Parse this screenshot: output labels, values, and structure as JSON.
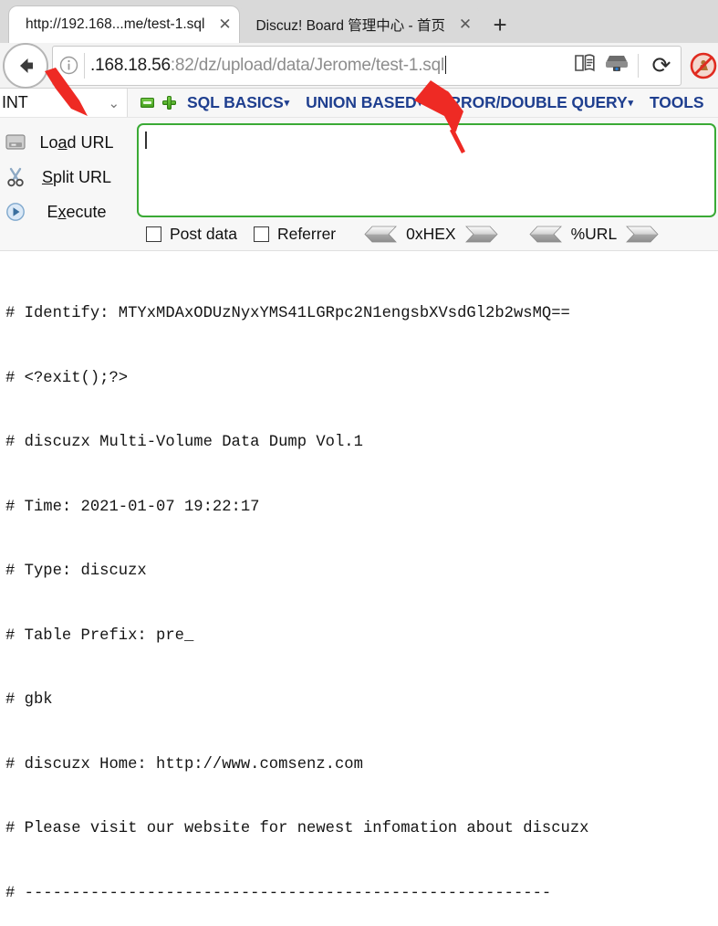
{
  "browser": {
    "tabs": [
      {
        "title": "http://192.168...me/test-1.sql",
        "close_label": "✕",
        "active": true
      },
      {
        "title": "Discuz! Board 管理中心 - 首页",
        "close_label": "✕",
        "active": false
      }
    ],
    "new_tab_label": "+",
    "navigation": {
      "back_label": "←",
      "identity_label": "ⓘ",
      "url_prefix": ".168.18.56",
      "url_port_path": ":82/dz/upload/data/Jerome/test-1.sql",
      "url_full": ".168.18.56:82/dz/upload/data/Jerome/test-1.sql",
      "reload_label": "⟳"
    }
  },
  "hackbar": {
    "type_selector": {
      "value": "INT",
      "chevron": "⌄"
    },
    "menu": [
      {
        "label": "SQL BASICS",
        "arrow": "▾"
      },
      {
        "label": "UNION BASED",
        "arrow": "▾"
      },
      {
        "label": "ERROR/DOUBLE QUERY",
        "arrow": "▾"
      },
      {
        "label": "TOOLS",
        "arrow": ""
      }
    ],
    "actions": [
      {
        "label_pre": "Lo",
        "label_key": "a",
        "label_post": "d URL",
        "icon": "drive-icon"
      },
      {
        "label_pre": "",
        "label_key": "S",
        "label_post": "plit URL",
        "icon": "scissors-icon"
      },
      {
        "label_pre": "E",
        "label_key": "x",
        "label_post": "ecute",
        "icon": "execute-icon"
      }
    ],
    "textarea_value": "",
    "options": [
      {
        "label": "Post data",
        "checked": false
      },
      {
        "label": "Referrer",
        "checked": false
      }
    ],
    "encoders": [
      {
        "label": "0xHEX"
      },
      {
        "label": "%URL"
      }
    ]
  },
  "document": {
    "lines": [
      "# Identify: MTYxMDAxODUzNyxYMS41LGRpc2N1engsbXVsdGl2b2wsMQ==",
      "# <?exit();?>",
      "# discuzx Multi-Volume Data Dump Vol.1",
      "# Time: 2021-01-07 19:22:17",
      "# Type: discuzx",
      "# Table Prefix: pre_",
      "# gbk",
      "# discuzx Home: http://www.comsenz.com",
      "# Please visit our website for newest infomation about discuzx",
      "# --------------------------------------------------------"
    ]
  },
  "colors": {
    "accent_green": "#3aaa35",
    "menu_blue": "#1f3f8f",
    "annotation_red": "#ee2a24",
    "tabstrip_gray": "#d9d9d9"
  }
}
